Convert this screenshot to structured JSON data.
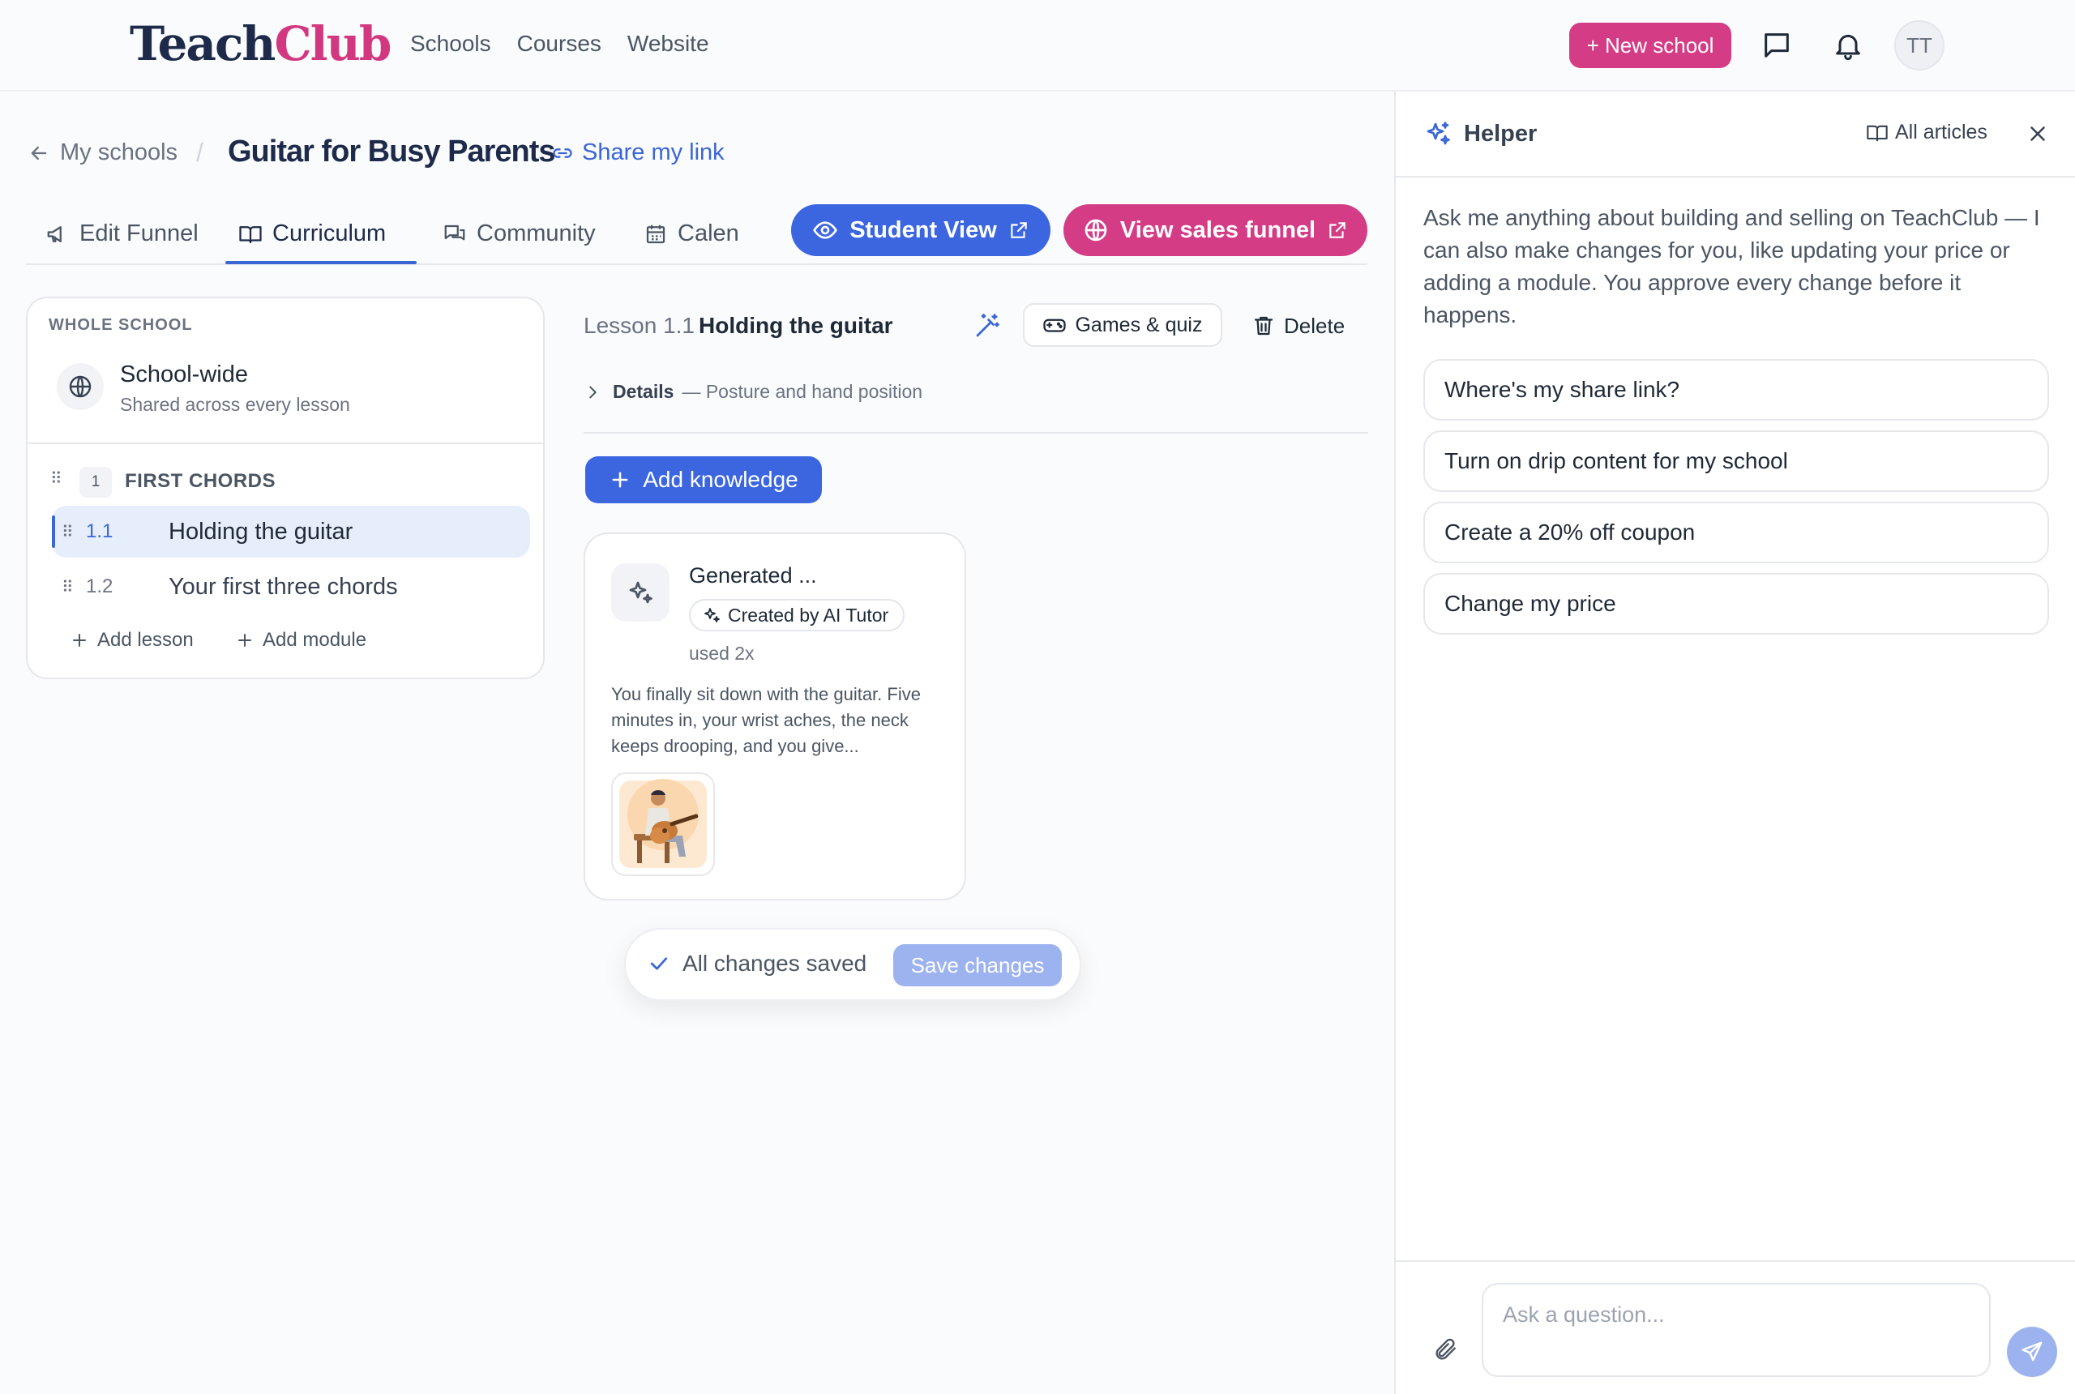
{
  "brand": {
    "part1": "Teach",
    "part2": "Club"
  },
  "nav": [
    "Schools",
    "Courses",
    "Website"
  ],
  "topbar": {
    "new_school_label": "+ New school",
    "avatar_initials": "TT"
  },
  "breadcrumb": {
    "back_label": "My schools",
    "separator": "/",
    "title": "Guitar for Busy Parents",
    "share_label": "Share my link"
  },
  "tabs": [
    {
      "label": "Edit Funnel"
    },
    {
      "label": "Curriculum"
    },
    {
      "label": "Community"
    },
    {
      "label": "Calen"
    }
  ],
  "actions": {
    "student_view_label": "Student View",
    "sales_funnel_label": "View sales funnel"
  },
  "curriculum": {
    "section_label": "WHOLE SCHOOL",
    "school_wide": {
      "title": "School-wide",
      "subtitle": "Shared across every lesson"
    },
    "module": {
      "number": "1",
      "title": "FIRST CHORDS"
    },
    "lessons": [
      {
        "number": "1.1",
        "title": "Holding the guitar"
      },
      {
        "number": "1.2",
        "title": "Your first three chords"
      }
    ],
    "add_lesson_label": "Add lesson",
    "add_module_label": "Add module"
  },
  "lesson": {
    "label": "Lesson 1.1",
    "title": "Holding the guitar",
    "games_label": "Games & quiz",
    "delete_label": "Delete",
    "details_label": "Details",
    "details_summary": "— Posture and hand position",
    "add_knowledge_label": "Add knowledge"
  },
  "knowledge_card": {
    "title": "Generated ...",
    "badge": "Created by AI Tutor",
    "usage": "used 2x",
    "excerpt": "You finally sit down with the guitar. Five minutes in, your wrist aches, the neck keeps drooping, and you give..."
  },
  "save_bar": {
    "status": "All changes saved",
    "save_label": "Save changes"
  },
  "helper": {
    "title": "Helper",
    "all_articles_label": "All articles",
    "intro": "Ask me anything about building and selling on TeachClub — I can also make changes for you, like updating your price or adding a module. You approve every change before it happens.",
    "suggestions": [
      "Where's my share link?",
      "Turn on drip content for my school",
      "Create a 20% off coupon",
      "Change my price"
    ],
    "input_placeholder": "Ask a question..."
  },
  "colors": {
    "brand_pink": "#d43c85",
    "primary_blue": "#3b66e0",
    "navy": "#1e2a4a"
  }
}
